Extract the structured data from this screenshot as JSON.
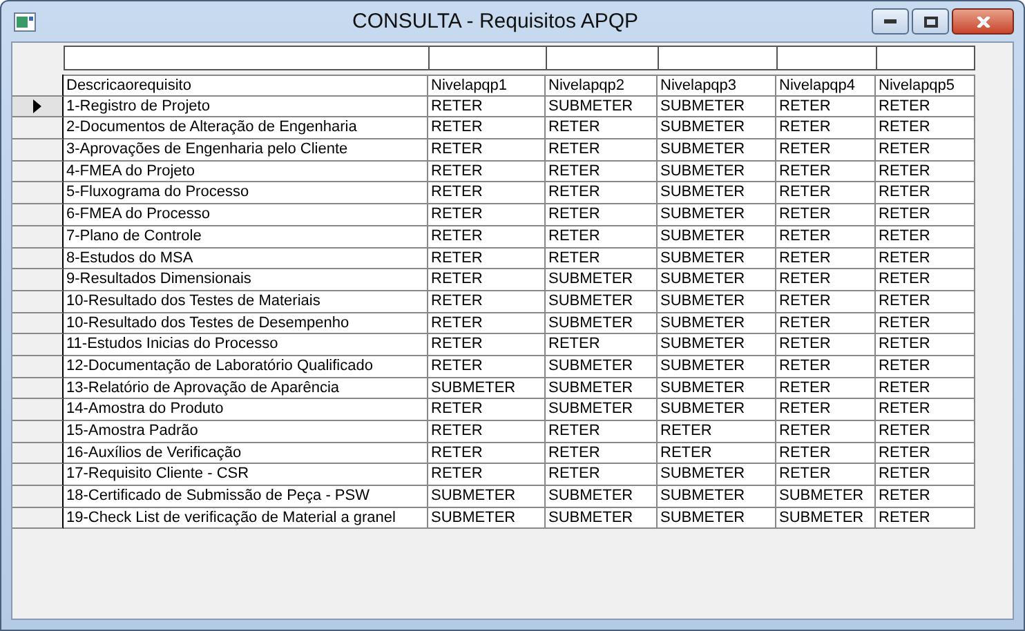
{
  "window": {
    "title": "CONSULTA - Requisitos APQP"
  },
  "table": {
    "columns": [
      "Descricaorequisito",
      "Nivelapqp1",
      "Nivelapqp2",
      "Nivelapqp3",
      "Nivelapqp4",
      "Nivelapqp5"
    ],
    "rows": [
      {
        "selected": true,
        "cells": [
          "1-Registro de Projeto",
          "RETER",
          "SUBMETER",
          "SUBMETER",
          "RETER",
          "RETER"
        ]
      },
      {
        "selected": false,
        "cells": [
          "2-Documentos de Alteração de Engenharia",
          "RETER",
          "RETER",
          "SUBMETER",
          "RETER",
          "RETER"
        ]
      },
      {
        "selected": false,
        "cells": [
          "3-Aprovações de Engenharia pelo Cliente",
          "RETER",
          "RETER",
          "SUBMETER",
          "RETER",
          "RETER"
        ]
      },
      {
        "selected": false,
        "cells": [
          "4-FMEA do Projeto",
          "RETER",
          "RETER",
          "SUBMETER",
          "RETER",
          "RETER"
        ]
      },
      {
        "selected": false,
        "cells": [
          "5-Fluxograma do Processo",
          "RETER",
          "RETER",
          "SUBMETER",
          "RETER",
          "RETER"
        ]
      },
      {
        "selected": false,
        "cells": [
          "6-FMEA do Processo",
          "RETER",
          "RETER",
          "SUBMETER",
          "RETER",
          "RETER"
        ]
      },
      {
        "selected": false,
        "cells": [
          "7-Plano de Controle",
          "RETER",
          "RETER",
          "SUBMETER",
          "RETER",
          "RETER"
        ]
      },
      {
        "selected": false,
        "cells": [
          "8-Estudos do MSA",
          "RETER",
          "RETER",
          "SUBMETER",
          "RETER",
          "RETER"
        ]
      },
      {
        "selected": false,
        "cells": [
          "9-Resultados Dimensionais",
          "RETER",
          "SUBMETER",
          "SUBMETER",
          "RETER",
          "RETER"
        ]
      },
      {
        "selected": false,
        "cells": [
          "10-Resultado dos Testes de Materiais",
          "RETER",
          "SUBMETER",
          "SUBMETER",
          "RETER",
          "RETER"
        ]
      },
      {
        "selected": false,
        "cells": [
          "10-Resultado dos Testes de Desempenho",
          "RETER",
          "SUBMETER",
          "SUBMETER",
          "RETER",
          "RETER"
        ]
      },
      {
        "selected": false,
        "cells": [
          "11-Estudos Inicias do Processo",
          "RETER",
          "RETER",
          "SUBMETER",
          "RETER",
          "RETER"
        ]
      },
      {
        "selected": false,
        "cells": [
          "12-Documentação de Laboratório Qualificado",
          "RETER",
          "SUBMETER",
          "SUBMETER",
          "RETER",
          "RETER"
        ]
      },
      {
        "selected": false,
        "cells": [
          "13-Relatório de Aprovação de Aparência",
          "SUBMETER",
          "SUBMETER",
          "SUBMETER",
          "RETER",
          "RETER"
        ]
      },
      {
        "selected": false,
        "cells": [
          "14-Amostra do Produto",
          "RETER",
          "SUBMETER",
          "SUBMETER",
          "RETER",
          "RETER"
        ]
      },
      {
        "selected": false,
        "cells": [
          "15-Amostra Padrão",
          "RETER",
          "RETER",
          "RETER",
          "RETER",
          "RETER"
        ]
      },
      {
        "selected": false,
        "cells": [
          "16-Auxílios de Verificação",
          "RETER",
          "RETER",
          "RETER",
          "RETER",
          "RETER"
        ]
      },
      {
        "selected": false,
        "cells": [
          "17-Requisito Cliente - CSR",
          "RETER",
          "RETER",
          "SUBMETER",
          "RETER",
          "RETER"
        ]
      },
      {
        "selected": false,
        "cells": [
          "18-Certificado de Submissão de Peça - PSW",
          "SUBMETER",
          "SUBMETER",
          "SUBMETER",
          "SUBMETER",
          "RETER"
        ]
      },
      {
        "selected": false,
        "cells": [
          "19-Check List de verificação de Material a granel",
          "SUBMETER",
          "SUBMETER",
          "SUBMETER",
          "SUBMETER",
          "RETER"
        ]
      }
    ]
  }
}
